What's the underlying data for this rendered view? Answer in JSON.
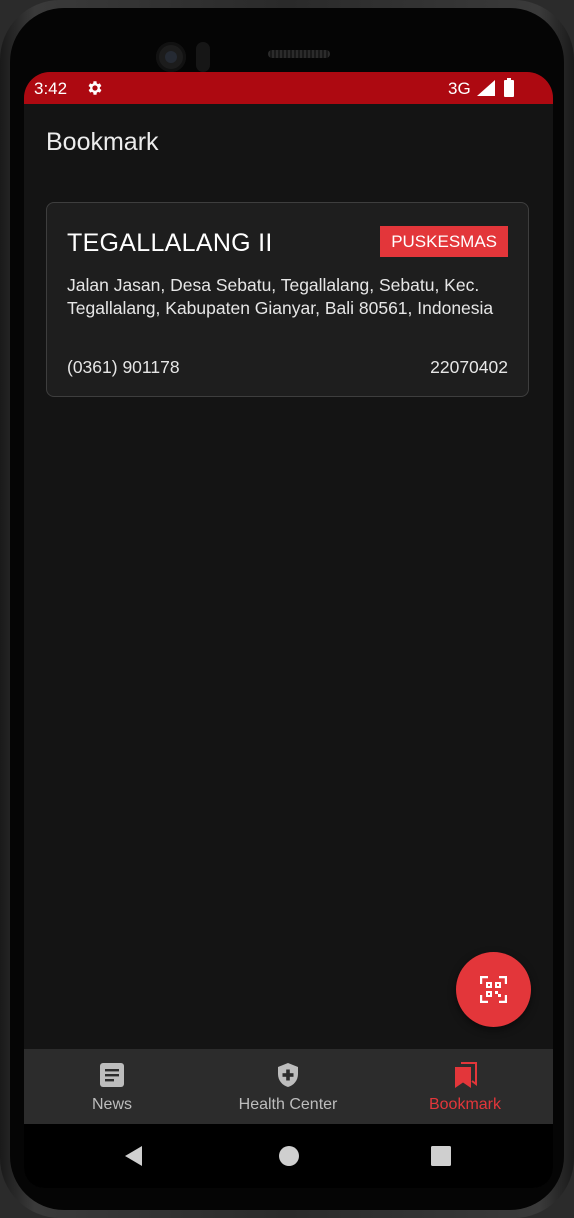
{
  "status_bar": {
    "time": "3:42",
    "network": "3G",
    "background_color": "#ad0911"
  },
  "app_bar": {
    "title": "Bookmark"
  },
  "bookmarks": [
    {
      "name": "TEGALLALANG II",
      "type_badge": "PUSKESMAS",
      "address": "Jalan Jasan, Desa Sebatu, Tegallalang, Sebatu, Kec. Tegallalang, Kabupaten Gianyar, Bali 80561, Indonesia",
      "phone": "(0361) 901178",
      "code": "22070402"
    }
  ],
  "fab": {
    "icon": "qr-scan-icon"
  },
  "bottom_nav": {
    "items": [
      {
        "label": "News",
        "icon": "news-icon",
        "active": false
      },
      {
        "label": "Health Center",
        "icon": "shield-plus-icon",
        "active": false
      },
      {
        "label": "Bookmark",
        "icon": "bookmark-icon",
        "active": true
      }
    ]
  },
  "colors": {
    "accent": "#e3363a",
    "background": "#141414",
    "card": "#1e1e1e",
    "nav_background": "#2c2c2c"
  }
}
